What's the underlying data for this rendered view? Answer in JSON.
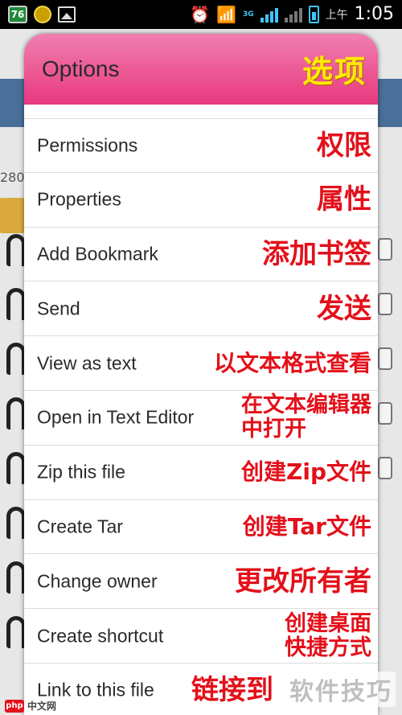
{
  "status_bar": {
    "badge": "76",
    "network_label": "3G",
    "ampm": "上午",
    "time": "1:05"
  },
  "background": {
    "left_text": "280"
  },
  "dialog": {
    "title": "Options",
    "title_annotation": "选项",
    "items": [
      {
        "label": "Permissions",
        "annotation": "权限"
      },
      {
        "label": "Properties",
        "annotation": "属性"
      },
      {
        "label": "Add Bookmark",
        "annotation": "添加书签"
      },
      {
        "label": "Send",
        "annotation": "发送"
      },
      {
        "label": "View as text",
        "annotation": "以文本格式查看"
      },
      {
        "label": "Open in Text Editor",
        "annotation_line1": "在文本编辑器",
        "annotation_line2": "中打开"
      },
      {
        "label": "Zip this file",
        "annotation": "创建Zip文件"
      },
      {
        "label": "Create Tar",
        "annotation": "创建Tar文件"
      },
      {
        "label": "Change owner",
        "annotation": "更改所有者"
      },
      {
        "label": "Create shortcut",
        "annotation_line1": "创建桌面",
        "annotation_line2": "快捷方式"
      },
      {
        "label": "Link to this file",
        "annotation": "链接到"
      }
    ]
  },
  "watermark": "软件技巧",
  "logo": {
    "mark": "php",
    "text": "中文网"
  }
}
